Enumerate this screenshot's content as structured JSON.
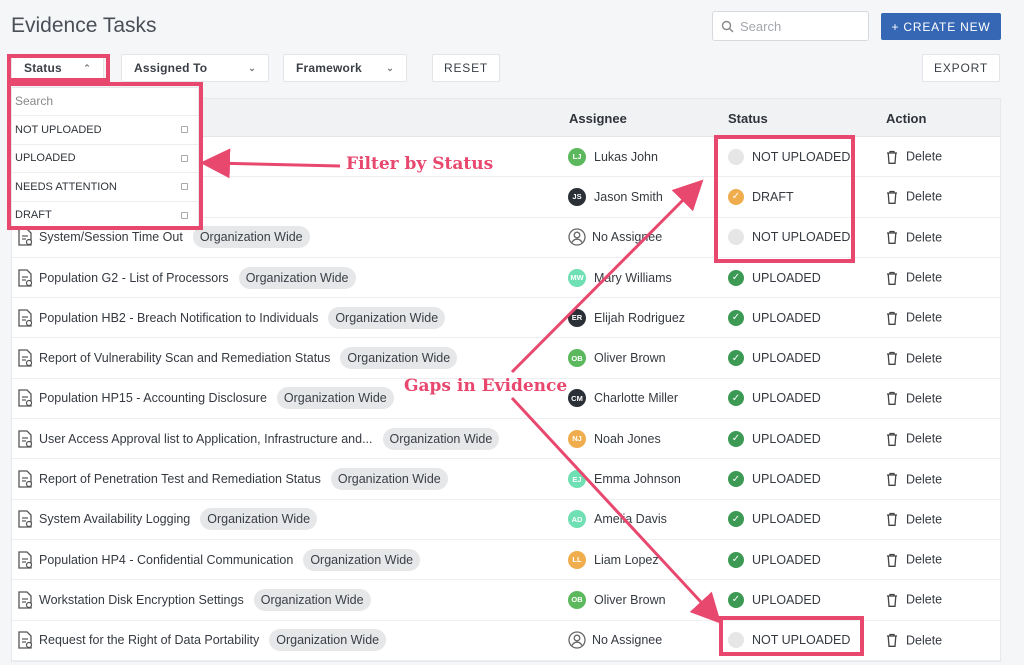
{
  "header": {
    "title": "Evidence Tasks",
    "search_placeholder": "Search",
    "create_label": "+ CREATE NEW"
  },
  "filters": {
    "status": "Status",
    "assigned_to": "Assigned To",
    "framework": "Framework",
    "reset": "RESET",
    "export": "EXPORT"
  },
  "status_dropdown": {
    "search_placeholder": "Search",
    "options": [
      "NOT UPLOADED",
      "UPLOADED",
      "NEEDS ATTENTION",
      "DRAFT"
    ]
  },
  "table": {
    "columns": {
      "assignee": "Assignee",
      "status": "Status",
      "action": "Action"
    },
    "rows": [
      {
        "task": "",
        "tag": "",
        "assignee": "Lukas John",
        "initials": "LJ",
        "avatar_color": "#5cb85c",
        "status": "NOT UPLOADED",
        "action": "Delete"
      },
      {
        "task": "",
        "tag": "",
        "assignee": "Jason Smith",
        "initials": "JS",
        "avatar_color": "#2b2f36",
        "status": "DRAFT",
        "action": "Delete"
      },
      {
        "task": "System/Session Time Out",
        "tag": "Organization Wide",
        "assignee": "No Assignee",
        "initials": "",
        "avatar_color": "",
        "status": "NOT UPLOADED",
        "action": "Delete"
      },
      {
        "task": "Population G2 - List of Processors",
        "tag": "Organization Wide",
        "assignee": "Mary Williams",
        "initials": "MW",
        "avatar_color": "#6ee0b4",
        "status": "UPLOADED",
        "action": "Delete"
      },
      {
        "task": "Population HB2 - Breach Notification to Individuals",
        "tag": "Organization Wide",
        "assignee": "Elijah Rodriguez",
        "initials": "ER",
        "avatar_color": "#2b2f36",
        "status": "UPLOADED",
        "action": "Delete"
      },
      {
        "task": "Report of Vulnerability Scan and Remediation Status",
        "tag": "Organization Wide",
        "assignee": "Oliver Brown",
        "initials": "OB",
        "avatar_color": "#5cb85c",
        "status": "UPLOADED",
        "action": "Delete"
      },
      {
        "task": "Population HP15 - Accounting Disclosure",
        "tag": "Organization Wide",
        "assignee": "Charlotte Miller",
        "initials": "CM",
        "avatar_color": "#2b2f36",
        "status": "UPLOADED",
        "action": "Delete"
      },
      {
        "task": "User Access Approval list to Application, Infrastructure and...",
        "tag": "Organization Wide",
        "assignee": "Noah Jones",
        "initials": "NJ",
        "avatar_color": "#f0ad4e",
        "status": "UPLOADED",
        "action": "Delete"
      },
      {
        "task": "Report of Penetration Test and Remediation Status",
        "tag": "Organization Wide",
        "assignee": "Emma Johnson",
        "initials": "EJ",
        "avatar_color": "#6ee0b4",
        "status": "UPLOADED",
        "action": "Delete"
      },
      {
        "task": "System Availability Logging",
        "tag": "Organization Wide",
        "assignee": "Amelia Davis",
        "initials": "AD",
        "avatar_color": "#6ee0b4",
        "status": "UPLOADED",
        "action": "Delete"
      },
      {
        "task": "Population HP4 - Confidential Communication",
        "tag": "Organization Wide",
        "assignee": "Liam Lopez",
        "initials": "LL",
        "avatar_color": "#f0ad4e",
        "status": "UPLOADED",
        "action": "Delete"
      },
      {
        "task": "Workstation Disk Encryption Settings",
        "tag": "Organization Wide",
        "assignee": "Oliver Brown",
        "initials": "OB",
        "avatar_color": "#5cb85c",
        "status": "UPLOADED",
        "action": "Delete"
      },
      {
        "task": "Request for the Right of Data Portability",
        "tag": "Organization Wide",
        "assignee": "No Assignee",
        "initials": "",
        "avatar_color": "",
        "status": "NOT UPLOADED",
        "action": "Delete"
      }
    ]
  },
  "status_colors": {
    "UPLOADED": "#3d9a54",
    "DRAFT": "#f0ad4e",
    "NOT UPLOADED": "#e6e6e6"
  },
  "annotations": {
    "filter_label": "Filter by Status",
    "gaps_label": "Gaps in Evidence",
    "color": "#e8476e"
  }
}
